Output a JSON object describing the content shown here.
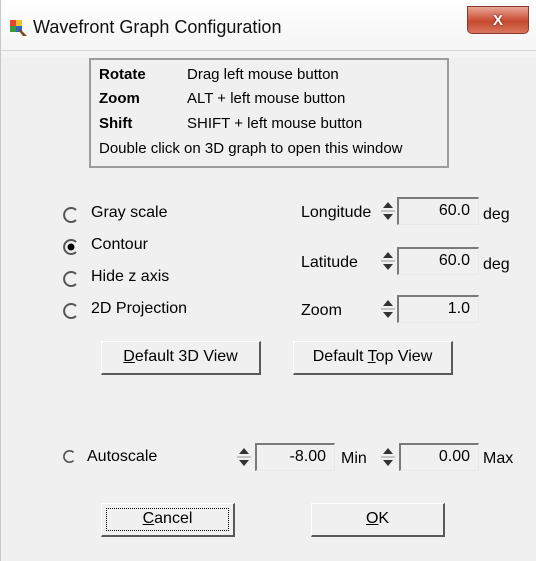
{
  "window": {
    "title": "Wavefront Graph Configuration",
    "close_label": "X"
  },
  "help": {
    "rows": [
      {
        "key": "Rotate",
        "value": "Drag left mouse button"
      },
      {
        "key": "Zoom",
        "value": "ALT + left mouse button"
      },
      {
        "key": "Shift",
        "value": "SHIFT + left mouse button"
      }
    ],
    "note": "Double click on 3D graph to open this window"
  },
  "display_mode": {
    "options": [
      "Gray scale",
      "Contour",
      "Hide z axis",
      "2D Projection"
    ],
    "selected": "Contour"
  },
  "view": {
    "longitude_label": "Longitude",
    "longitude_value": "60.0",
    "longitude_unit": "deg",
    "latitude_label": "Latitude",
    "latitude_value": "60.0",
    "latitude_unit": "deg",
    "zoom_label": "Zoom",
    "zoom_value": "1.0"
  },
  "buttons": {
    "default_3d_pre": "",
    "default_3d_accel": "D",
    "default_3d_post": "efault 3D View",
    "default_top_pre": "Default ",
    "default_top_accel": "T",
    "default_top_post": "op View",
    "cancel_pre": "",
    "cancel_accel": "C",
    "cancel_post": "ancel",
    "ok_pre": "",
    "ok_accel": "O",
    "ok_post": "K"
  },
  "scale": {
    "autoscale_label": "Autoscale",
    "autoscale_checked": false,
    "min_value": "-8.00",
    "min_label": "Min",
    "max_value": "0.00",
    "max_label": "Max"
  },
  "colors": {
    "window_bg": "#f0f0f0",
    "close_button": "#c44a30"
  }
}
